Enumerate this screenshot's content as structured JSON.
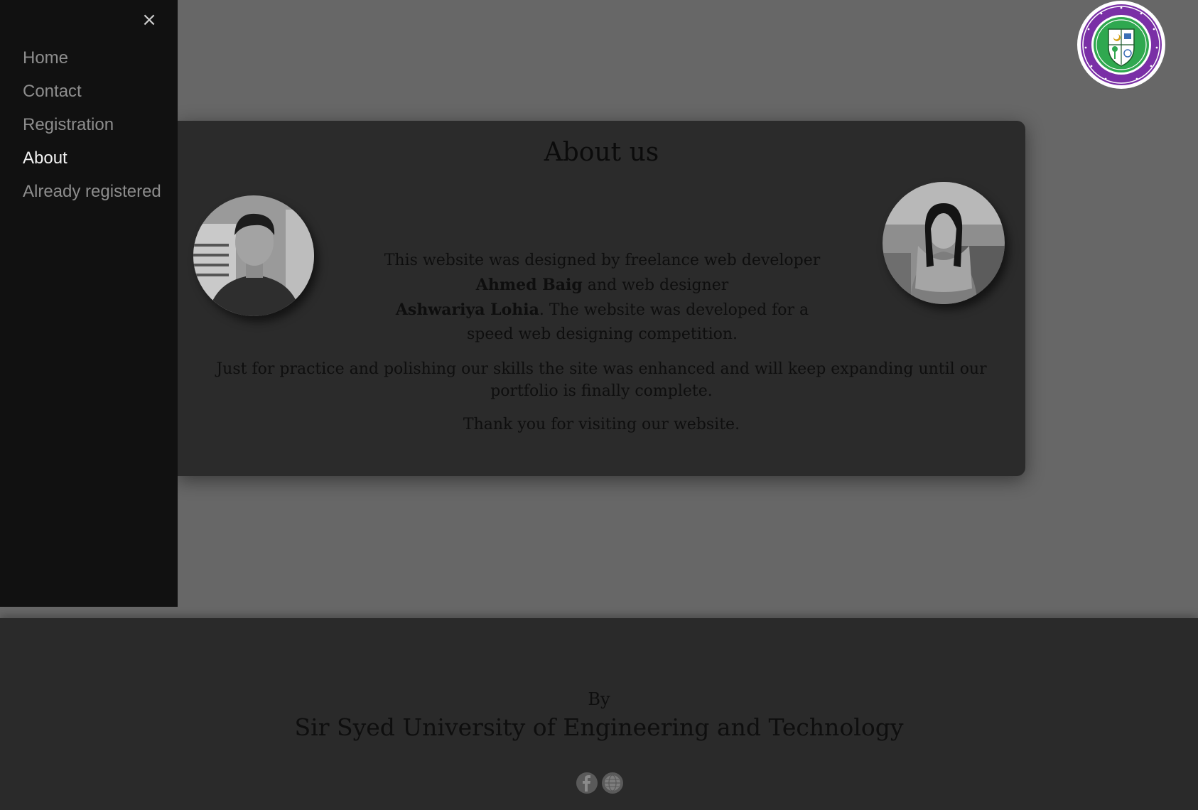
{
  "sidebar": {
    "close_label": "×",
    "items": [
      {
        "label": "Home",
        "active": false
      },
      {
        "label": "Contact",
        "active": false
      },
      {
        "label": "Registration",
        "active": false
      },
      {
        "label": "About",
        "active": true
      },
      {
        "label": "Already registered",
        "active": false
      }
    ]
  },
  "logo": {
    "name": "Sir Syed University of Engineering & Technology seal",
    "ring_text": "SIR SYED UNIVERSITY OF ENGINEERING & TECHNOLOGY · KARACHI",
    "colors": {
      "ring": "#7a2fa6",
      "inner": "#2fa84f",
      "border": "#ffffff"
    }
  },
  "about": {
    "title": "About us",
    "intro_line1": "This website was designed by freelance web developer",
    "developer_name": "Ahmed Baig",
    "intro_mid": " and web designer",
    "designer_name": "Ashwariya Lohia",
    "intro_end": ". The website was developed for a speed web designing competition.",
    "paragraph2": "Just for practice and polishing our skills the site was enhanced and will keep expanding until our portfolio is finally complete.",
    "paragraph3": "Thank you for visiting our website.",
    "photos": [
      "developer-photo",
      "designer-photo"
    ]
  },
  "footer": {
    "by_label": "By",
    "university": "Sir Syed University of Engineering and Technology",
    "social": [
      "facebook-icon",
      "website-icon"
    ]
  },
  "colors": {
    "page_bg": "#676767",
    "sidebar_bg": "#111111",
    "card_bg": "#2b2b2b",
    "footer_bg": "#2a2a2a",
    "nav_text": "#8d8d8d",
    "nav_active": "#f2f2f2"
  }
}
